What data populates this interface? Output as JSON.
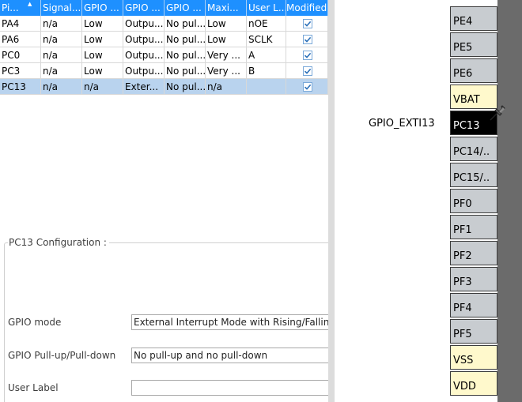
{
  "table": {
    "columns": [
      "Pi...",
      "Signal...",
      "GPIO ...",
      "GPIO ...",
      "GPIO ...",
      "Maxi...",
      "User L...",
      "Modified"
    ],
    "rows": [
      {
        "pin": "PA4",
        "signal": "n/a",
        "output_level": "Low",
        "mode": "Outpu...",
        "pull": "No pul...",
        "max_speed": "Low",
        "user_label": "nOE",
        "modified": true
      },
      {
        "pin": "PA6",
        "signal": "n/a",
        "output_level": "Low",
        "mode": "Outpu...",
        "pull": "No pul...",
        "max_speed": "Low",
        "user_label": "SCLK",
        "modified": true
      },
      {
        "pin": "PC0",
        "signal": "n/a",
        "output_level": "Low",
        "mode": "Outpu...",
        "pull": "No pul...",
        "max_speed": "Very ...",
        "user_label": "A",
        "modified": true
      },
      {
        "pin": "PC3",
        "signal": "n/a",
        "output_level": "Low",
        "mode": "Outpu...",
        "pull": "No pul...",
        "max_speed": "Very ...",
        "user_label": "B",
        "modified": true
      },
      {
        "pin": "PC13",
        "signal": "n/a",
        "output_level": "n/a",
        "mode": "Exter...",
        "pull": "No pul...",
        "max_speed": "n/a",
        "user_label": "",
        "modified": true,
        "selected": true
      }
    ]
  },
  "config": {
    "legend": "PC13 Configuration :",
    "gpio_mode_label": "GPIO mode",
    "gpio_mode_value": "External Interrupt Mode with Rising/Falling",
    "pull_label": "GPIO Pull-up/Pull-down",
    "pull_value": "No pull-up and no pull-down",
    "user_label_label": "User Label",
    "user_label_value": ""
  },
  "chip": {
    "pins": [
      {
        "label": "PE4",
        "kind": "io"
      },
      {
        "label": "PE5",
        "kind": "io"
      },
      {
        "label": "PE6",
        "kind": "io"
      },
      {
        "label": "VBAT",
        "kind": "power"
      },
      {
        "label": "PC13",
        "kind": "active"
      },
      {
        "label": "PC14/..",
        "kind": "io"
      },
      {
        "label": "PC15/..",
        "kind": "io"
      },
      {
        "label": "PF0",
        "kind": "io"
      },
      {
        "label": "PF1",
        "kind": "io"
      },
      {
        "label": "PF2",
        "kind": "io"
      },
      {
        "label": "PF3",
        "kind": "io"
      },
      {
        "label": "PF4",
        "kind": "io"
      },
      {
        "label": "PF5",
        "kind": "io"
      },
      {
        "label": "VSS",
        "kind": "power"
      },
      {
        "label": "VDD",
        "kind": "power"
      }
    ],
    "signal_label": "GPIO_EXTI13",
    "pushpin_icon": "pushpin-icon"
  },
  "colors": {
    "header_blue": "#1e90ff",
    "selected_row": "#b9d3ee",
    "pin_gray": "#c8ccd0",
    "power_pin": "#fff9cc",
    "active_pin": "#000000"
  }
}
